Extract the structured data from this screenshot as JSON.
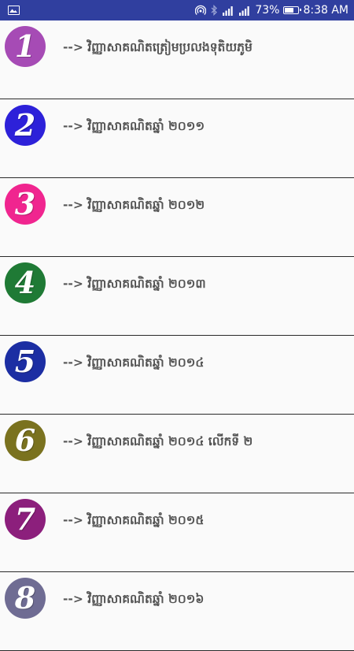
{
  "status_bar": {
    "gallery_icon": "image-icon",
    "battery_text": "73%",
    "battery_level": 0.73,
    "time": "8:38 AM",
    "bg_color": "#303f9f"
  },
  "list": {
    "items": [
      {
        "number": "1",
        "color": "#a64bb5",
        "label": "--> វិញ្ញាសាគណិតត្រៀមប្រលងទុតិយភូមិ"
      },
      {
        "number": "2",
        "color": "#2d21d9",
        "label": "--> វិញ្ញាសាគណិតឆ្នាំ ២០១១"
      },
      {
        "number": "3",
        "color": "#f0258f",
        "label": "--> វិញ្ញាសាគណិតឆ្នាំ ២០១២"
      },
      {
        "number": "4",
        "color": "#1f7a35",
        "label": "--> វិញ្ញាសាគណិតឆ្នាំ ២០១៣"
      },
      {
        "number": "5",
        "color": "#1c2ea3",
        "label": "--> វិញ្ញាសាគណិតឆ្នាំ ២០១៤"
      },
      {
        "number": "6",
        "color": "#7a721f",
        "label": "--> វិញ្ញាសាគណិតឆ្នាំ ២០១៤ លើកទី ២"
      },
      {
        "number": "7",
        "color": "#8c1f7c",
        "label": "--> វិញ្ញាសាគណិតឆ្នាំ ២០១៥"
      },
      {
        "number": "8",
        "color": "#6f6c93",
        "label": "--> វិញ្ញាសាគណិតឆ្នាំ ២០១៦"
      }
    ]
  }
}
